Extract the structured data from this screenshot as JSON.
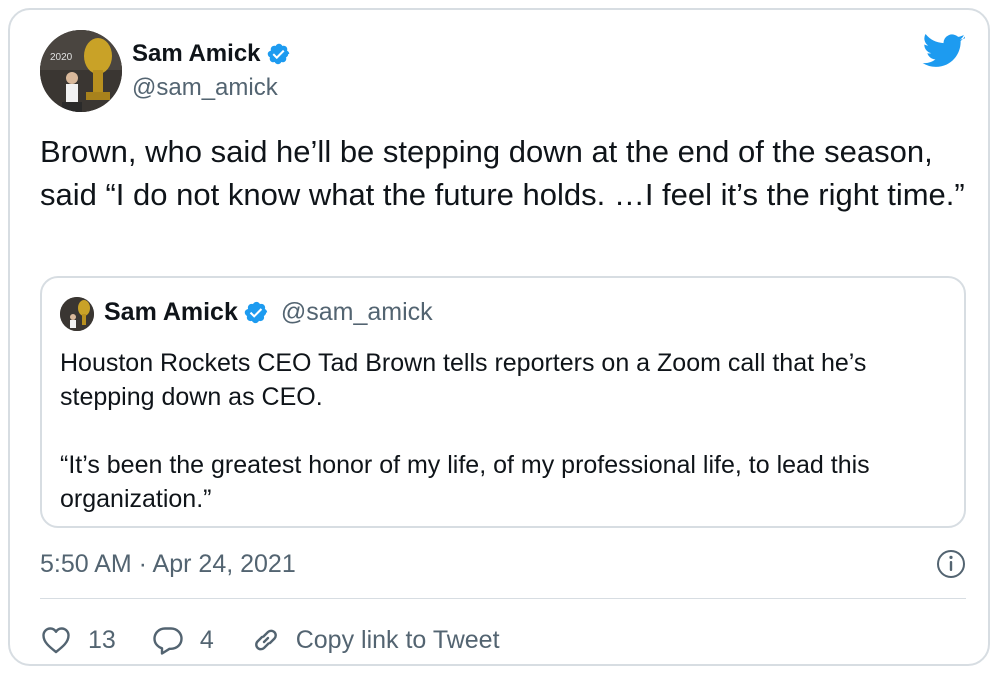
{
  "tweet": {
    "author_name": "Sam Amick",
    "author_handle": "@sam_amick",
    "text": "Brown, who said he’ll be stepping down at the end of the season, said “I do not know what the future holds. …I feel it’s the right time.”",
    "timestamp": "5:50 AM · Apr 24, 2021",
    "likes": "13",
    "replies": "4",
    "copy_link_label": "Copy link to Tweet"
  },
  "quote": {
    "author_name": "Sam Amick",
    "author_handle": "@sam_amick",
    "paragraph1": "Houston Rockets CEO Tad Brown tells reporters on a Zoom call that he’s stepping down as CEO.",
    "paragraph2": "“It’s been the greatest honor of my life, of my professional life, to lead this organization.”"
  },
  "colors": {
    "twitter_blue": "#1d9bf0",
    "secondary_text": "#536471",
    "border": "#d7dde2"
  },
  "icons": {
    "brand": "twitter-bird-icon",
    "verified": "verified-badge-icon",
    "info": "info-icon",
    "like": "heart-icon",
    "reply": "reply-bubble-icon",
    "copy": "link-icon"
  }
}
